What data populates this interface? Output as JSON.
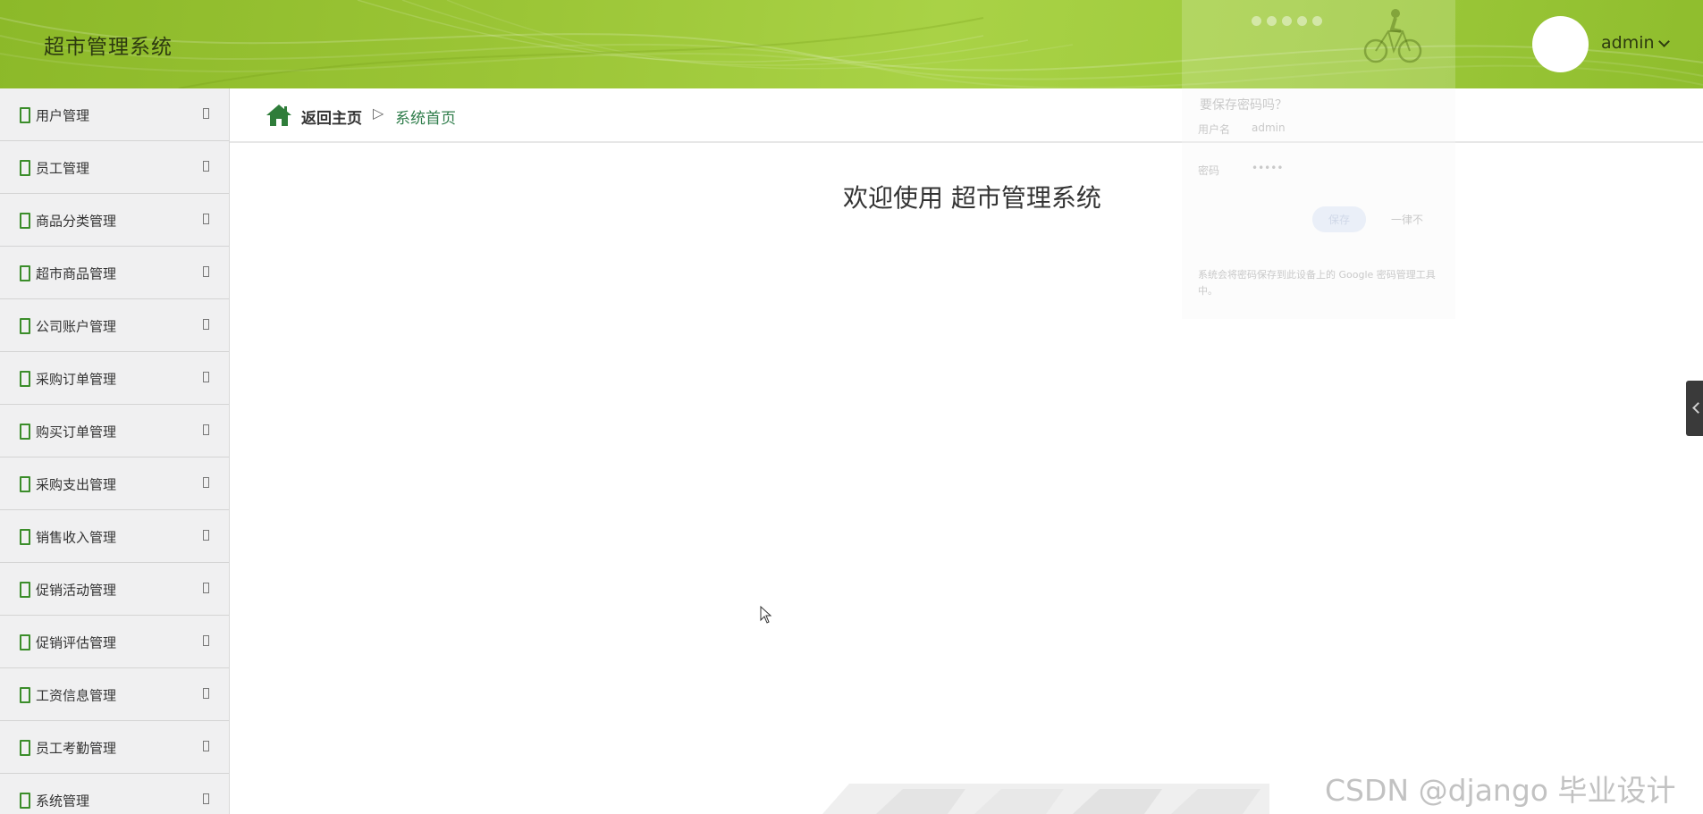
{
  "header": {
    "title": "超市管理系统",
    "user": "admin"
  },
  "sidebar": {
    "items": [
      {
        "label": "用户管理"
      },
      {
        "label": "员工管理"
      },
      {
        "label": "商品分类管理"
      },
      {
        "label": "超市商品管理"
      },
      {
        "label": "公司账户管理"
      },
      {
        "label": "采购订单管理"
      },
      {
        "label": "购买订单管理"
      },
      {
        "label": "采购支出管理"
      },
      {
        "label": "销售收入管理"
      },
      {
        "label": "促销活动管理"
      },
      {
        "label": "促销评估管理"
      },
      {
        "label": "工资信息管理"
      },
      {
        "label": "员工考勤管理"
      },
      {
        "label": "系统管理"
      }
    ]
  },
  "breadcrumb": {
    "home": "返回主页",
    "separator": "▷",
    "current": "系统首页"
  },
  "main": {
    "welcome": "欢迎使用 超市管理系统"
  },
  "password_popup": {
    "title": "要保存密码吗？",
    "username_label": "用户名",
    "username_value": "admin",
    "password_label": "密码",
    "password_value": "•••••",
    "save_button": "保存",
    "never_button": "一律不",
    "footnote": "系统会将密码保存到此设备上的 Google 密码管理工具中。"
  },
  "watermark": "CSDN @django 毕业设计",
  "colors": {
    "header_green": "#9bc536",
    "accent_green": "#3b8d2a",
    "breadcrumb_current": "#2f7d4b"
  }
}
